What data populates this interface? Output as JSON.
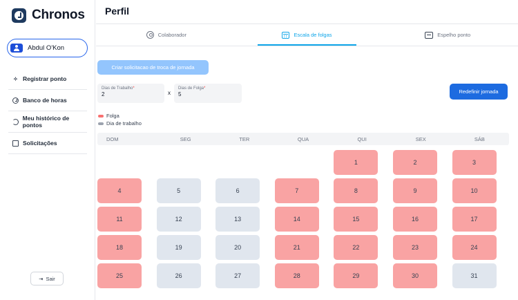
{
  "app": {
    "name": "Chronos"
  },
  "user": {
    "name": "Abdul O'Kon"
  },
  "sidebar": {
    "items": [
      {
        "label": "Registrar ponto",
        "icon": "sparkle-icon"
      },
      {
        "label": "Banco de horas",
        "icon": "clock-icon"
      },
      {
        "label": "Meu histórico de pontos",
        "icon": "history-icon"
      },
      {
        "label": "Solicitações",
        "icon": "document-icon"
      }
    ],
    "logout_label": "Sair"
  },
  "page": {
    "title": "Perfil"
  },
  "tabs": [
    {
      "label": "Colaborador",
      "icon": "user-circle-icon",
      "active": false
    },
    {
      "label": "Escala de folgas",
      "icon": "calendar-icon",
      "active": true
    },
    {
      "label": "Espelho ponto",
      "icon": "timesheet-icon",
      "active": false
    }
  ],
  "schedule": {
    "request_button": "Criar solicitacao de troca de jornada",
    "work_days_label": "Dias de Trabalho",
    "work_days_value": "2",
    "separator": "x",
    "off_days_label": "Dias de Folga",
    "off_days_value": "5",
    "required_mark": "*",
    "reset_button": "Redefinir jornada"
  },
  "legend": [
    {
      "label": "Folga",
      "color": "#f87171"
    },
    {
      "label": "Dia de trabalho",
      "color": "#9ca3af"
    }
  ],
  "colors": {
    "folga": "#f9a3a3",
    "trabalho": "#e0e6ee",
    "accent": "#0ea5e9",
    "primary": "#1d6be0"
  },
  "calendar": {
    "weekdays": [
      "DOM",
      "SEG",
      "TER",
      "QUA",
      "QUI",
      "SEX",
      "SÁB"
    ],
    "leading_blanks": 4,
    "days": [
      {
        "day": "1",
        "type": "folga"
      },
      {
        "day": "2",
        "type": "folga"
      },
      {
        "day": "3",
        "type": "folga"
      },
      {
        "day": "4",
        "type": "folga"
      },
      {
        "day": "5",
        "type": "trabalho"
      },
      {
        "day": "6",
        "type": "trabalho"
      },
      {
        "day": "7",
        "type": "folga"
      },
      {
        "day": "8",
        "type": "folga"
      },
      {
        "day": "9",
        "type": "folga"
      },
      {
        "day": "10",
        "type": "folga"
      },
      {
        "day": "11",
        "type": "folga"
      },
      {
        "day": "12",
        "type": "trabalho"
      },
      {
        "day": "13",
        "type": "trabalho"
      },
      {
        "day": "14",
        "type": "folga"
      },
      {
        "day": "15",
        "type": "folga"
      },
      {
        "day": "16",
        "type": "folga"
      },
      {
        "day": "17",
        "type": "folga"
      },
      {
        "day": "18",
        "type": "folga"
      },
      {
        "day": "19",
        "type": "trabalho"
      },
      {
        "day": "20",
        "type": "trabalho"
      },
      {
        "day": "21",
        "type": "folga"
      },
      {
        "day": "22",
        "type": "folga"
      },
      {
        "day": "23",
        "type": "folga"
      },
      {
        "day": "24",
        "type": "folga"
      },
      {
        "day": "25",
        "type": "folga"
      },
      {
        "day": "26",
        "type": "trabalho"
      },
      {
        "day": "27",
        "type": "trabalho"
      },
      {
        "day": "28",
        "type": "folga"
      },
      {
        "day": "29",
        "type": "folga"
      },
      {
        "day": "30",
        "type": "folga"
      },
      {
        "day": "31",
        "type": "trabalho"
      }
    ]
  }
}
